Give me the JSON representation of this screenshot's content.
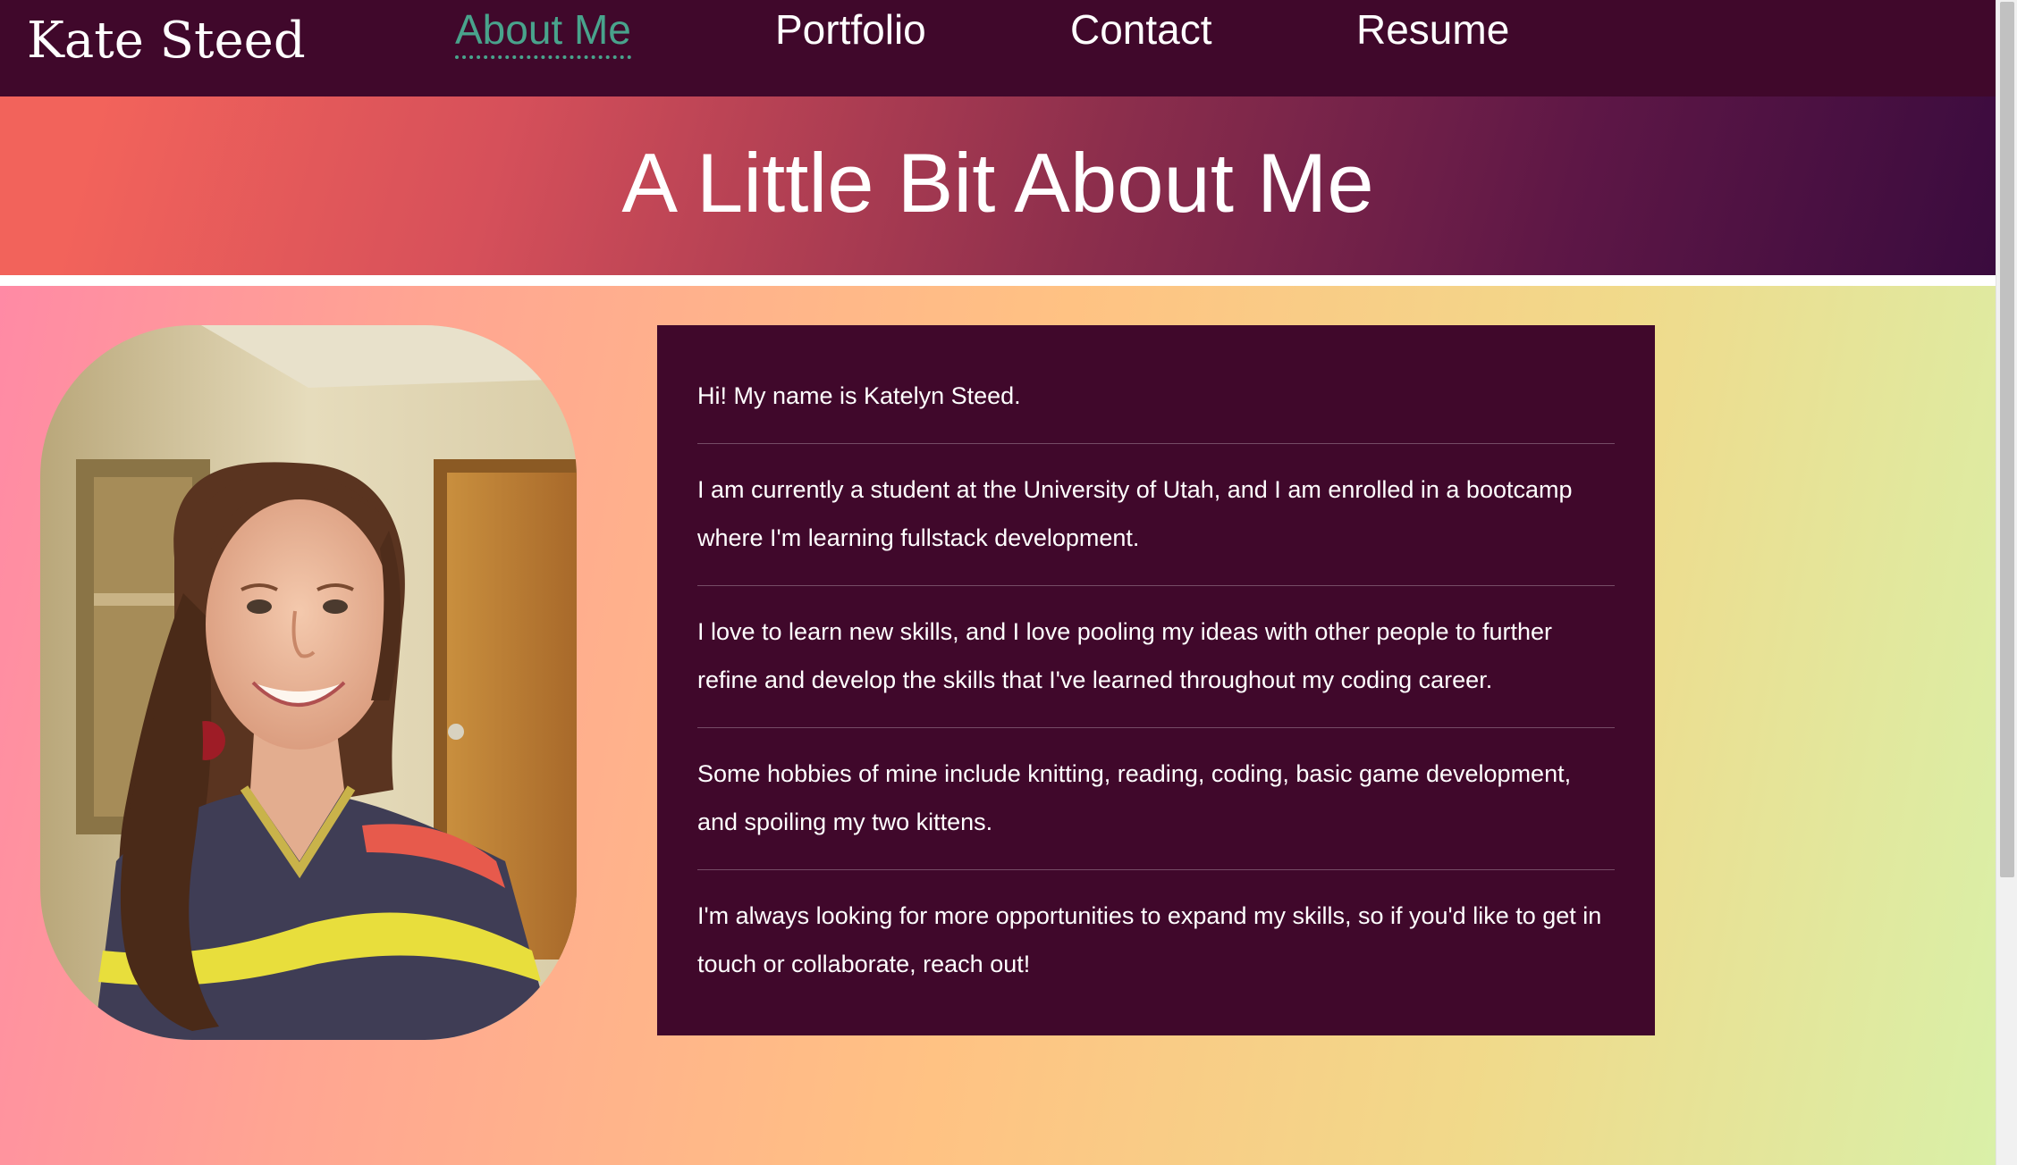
{
  "navbar": {
    "brand": "Kate Steed",
    "links": [
      {
        "label": "About Me",
        "active": true
      },
      {
        "label": "Portfolio",
        "active": false
      },
      {
        "label": "Contact",
        "active": false
      },
      {
        "label": "Resume",
        "active": false
      }
    ]
  },
  "hero": {
    "title": "A Little Bit About Me"
  },
  "about": {
    "paragraphs": [
      "Hi! My name is Katelyn Steed.",
      "I am currently a student at the University of Utah, and I am enrolled in a bootcamp where I'm learning fullstack development.",
      "I love to learn new skills, and I love pooling my ideas with other people to further refine and develop the skills that I've learned throughout my coding career.",
      "Some hobbies of mine include knitting, reading, coding, basic game development, and spoiling my two kittens.",
      "I'm always looking for more opportunities to expand my skills, so if you'd like to get in touch or collaborate, reach out!"
    ]
  },
  "colors": {
    "nav_background": "#40082b",
    "active_link": "#49a38c",
    "card_background": "#40082b",
    "text": "#ffffff"
  }
}
